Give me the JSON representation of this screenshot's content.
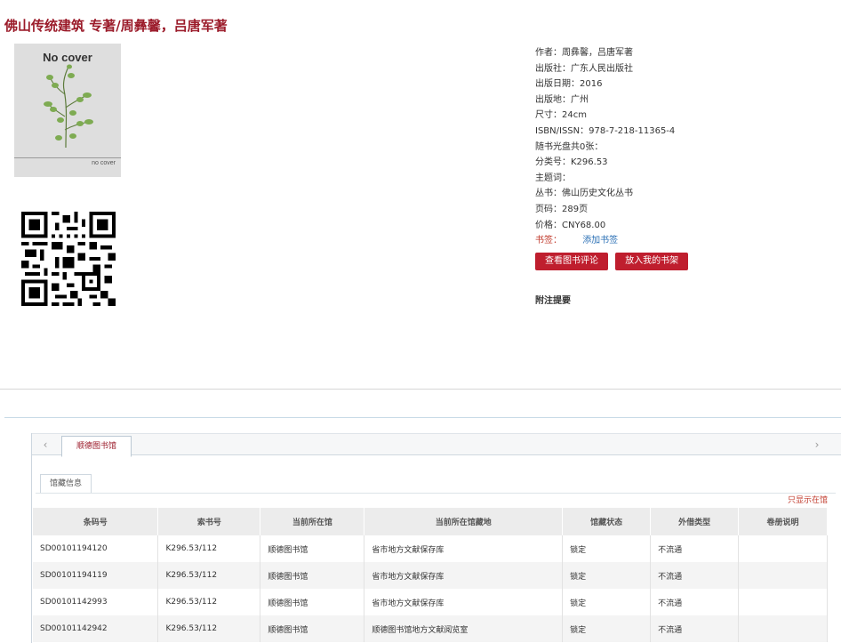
{
  "page": {
    "title": "佛山传统建筑 专著/周彝馨，吕唐军著"
  },
  "cover": {
    "top_text": "No cover",
    "bottom_text": "no cover"
  },
  "info": {
    "rows": [
      "作者：周彝馨，吕唐军著",
      "出版社：广东人民出版社",
      "出版日期：2016",
      "出版地：广州",
      "尺寸：24cm",
      "ISBN/ISSN：978-7-218-11365-4",
      "随书光盘共0张：",
      "分类号：K296.53",
      "主题词：",
      "丛书：佛山历史文化丛书",
      "页码：289页",
      "价格：CNY68.00"
    ],
    "tag_label": "书签：",
    "add_tag_link": "添加书签"
  },
  "buttons": {
    "review": "查看图书评论",
    "shelf": "放入我的书架"
  },
  "notes_heading": "附注提要",
  "holdings": {
    "library_tab": "顺德图书馆",
    "subtab": "馆藏信息",
    "only_this_link": "只显示在馆",
    "left_arrow": "‹",
    "right_arrow": "›",
    "columns": [
      "条码号",
      "索书号",
      "当前所在馆",
      "当前所在馆藏地",
      "馆藏状态",
      "外借类型",
      "卷册说明"
    ],
    "rows": [
      [
        "SD00101194120",
        "K296.53/112",
        "顺德图书馆",
        "省市地方文献保存库",
        "锁定",
        "不流通",
        ""
      ],
      [
        "SD00101194119",
        "K296.53/112",
        "顺德图书馆",
        "省市地方文献保存库",
        "锁定",
        "不流通",
        ""
      ],
      [
        "SD00101142993",
        "K296.53/112",
        "顺德图书馆",
        "省市地方文献保存库",
        "锁定",
        "不流通",
        ""
      ],
      [
        "SD00101142942",
        "K296.53/112",
        "顺德图书馆",
        "顺德图书馆地方文献阅览室",
        "锁定",
        "不流通",
        ""
      ]
    ]
  },
  "colors": {
    "title": "#9b1b2a",
    "button": "#bf1e2e",
    "link": "#2a6fb5"
  }
}
